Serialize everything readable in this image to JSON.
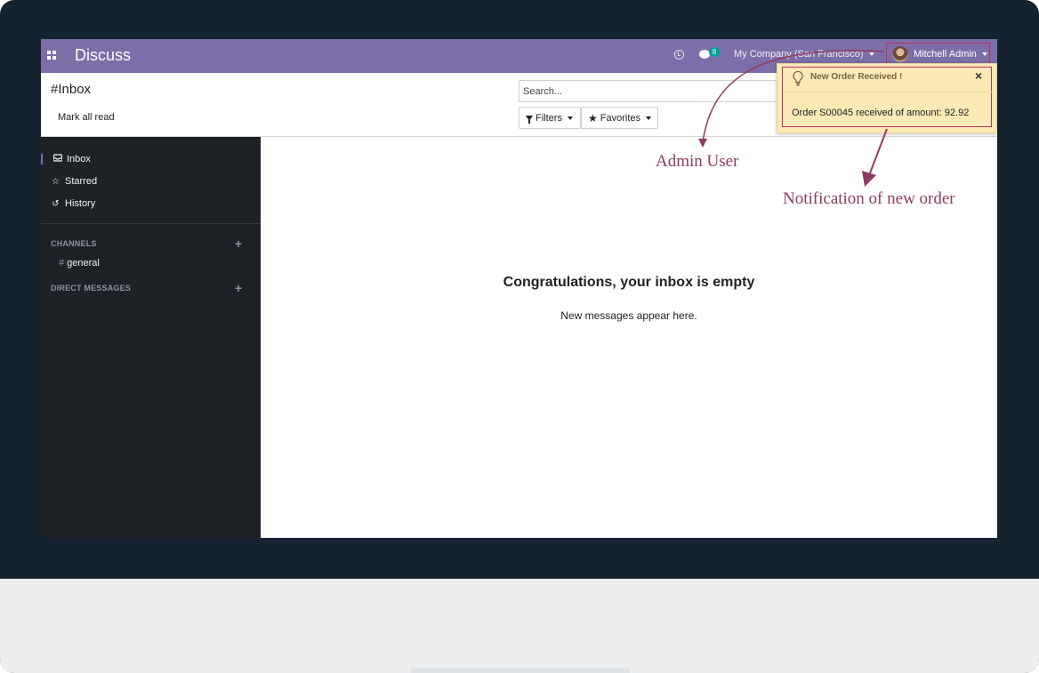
{
  "navbar": {
    "app_title": "Discuss",
    "chat_badge": "8",
    "company": "My Company (San Francisco)",
    "user_name": "Mitchell Admin",
    "bar_color": "#7c6ea8"
  },
  "control_panel": {
    "breadcrumb": "#Inbox",
    "mark_all_read": "Mark all read",
    "search_placeholder": "Search...",
    "filters_label": "Filters",
    "favorites_label": "Favorites"
  },
  "sidebar": {
    "items": [
      {
        "label": "Inbox",
        "icon": "inbox-icon"
      },
      {
        "label": "Starred",
        "icon": "star-icon"
      },
      {
        "label": "History",
        "icon": "history-icon"
      }
    ],
    "channels_header": "CHANNELS",
    "channels": [
      {
        "label": "general"
      }
    ],
    "direct_messages_header": "DIRECT MESSAGES"
  },
  "content": {
    "empty_title": "Congratulations, your inbox is empty",
    "empty_subtitle": "New messages appear here."
  },
  "notification": {
    "title": "New Order Received !",
    "body": "Order S00045 received of amount: 92.92",
    "close_glyph": "×"
  },
  "annotations": {
    "admin_user": "Admin User",
    "new_order": "Notification of new order",
    "color": "#8e3a63"
  }
}
